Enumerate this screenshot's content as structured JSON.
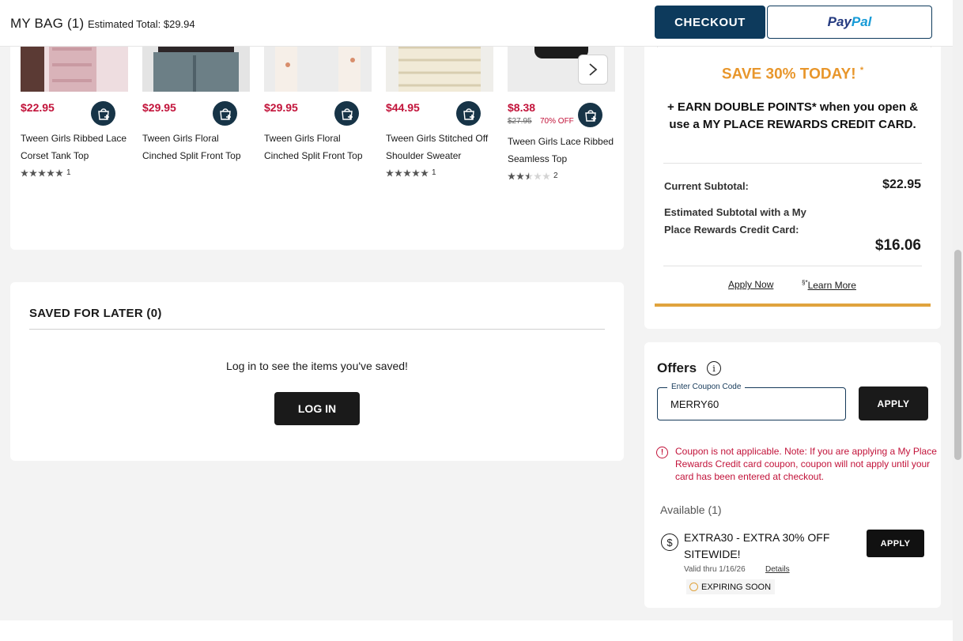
{
  "header": {
    "bag_label": "MY BAG (1)",
    "estimated_total": "Estimated Total: $29.94",
    "checkout_label": "CHECKOUT",
    "paypal_pay": "Pay",
    "paypal_pal": "Pal"
  },
  "recommendations": {
    "products": [
      {
        "price": "$22.95",
        "name": "Tween Girls Ribbed Lace Corset Tank Top",
        "rating": 5,
        "review_count": "1"
      },
      {
        "price": "$29.95",
        "name": "Tween Girls Floral Cinched Split Front Top",
        "rating": 0,
        "review_count": ""
      },
      {
        "price": "$29.95",
        "name": "Tween Girls Floral Cinched Split Front Top",
        "rating": 0,
        "review_count": ""
      },
      {
        "price": "$44.95",
        "name": "Tween Girls Stitched Off Shoulder Sweater",
        "rating": 5,
        "review_count": "1"
      },
      {
        "price": "$8.38",
        "original_price": "$27.95",
        "discount": "70% OFF",
        "name": "Tween Girls Lace Ribbed Seamless Top",
        "rating": 2.5,
        "review_count": "2"
      }
    ],
    "icons": {
      "add_to_bag": "bag-plus-icon",
      "next": "chevron-right-icon"
    }
  },
  "saved_for_later": {
    "heading": "SAVED FOR LATER (0)",
    "message": "Log in to see the items you've saved!",
    "login_label": "LOG IN"
  },
  "rewards_promo": {
    "save_text": "SAVE 30% TODAY!",
    "save_mark": "*",
    "earn_text": "+ EARN DOUBLE POINTS* when you open & use a MY PLACE REWARDS CREDIT CARD.",
    "current_subtotal_label": "Current Subtotal:",
    "current_subtotal_value": "$22.95",
    "estimated_label": "Estimated Subtotal with a My Place Rewards Credit Card:",
    "estimated_value": "$16.06",
    "apply_now": "Apply Now",
    "learn_mark": "§*",
    "learn_more": "Learn More"
  },
  "offers": {
    "title": "Offers",
    "info_glyph": "i",
    "coupon_label": "Enter Coupon Code",
    "coupon_value": "MERRY60",
    "apply_label": "APPLY",
    "error_glyph": "!",
    "error_message": "Coupon is not applicable. Note: If you are applying a My Place Rewards Credit card coupon, coupon will not apply until your card has been entered at checkout.",
    "available_label": "Available (1)",
    "offer": {
      "dollar_glyph": "$",
      "name": "EXTRA30 - EXTRA 30% OFF SITEWIDE!",
      "valid": "Valid thru 1/16/26",
      "details_label": "Details",
      "badge": "EXPIRING SOON",
      "apply_label": "APPLY"
    }
  },
  "colors": {
    "navy": "#0d3a5c",
    "price_red": "#c2133a",
    "promo_orange": "#e8962b",
    "gold_bar": "#e0a33d"
  }
}
